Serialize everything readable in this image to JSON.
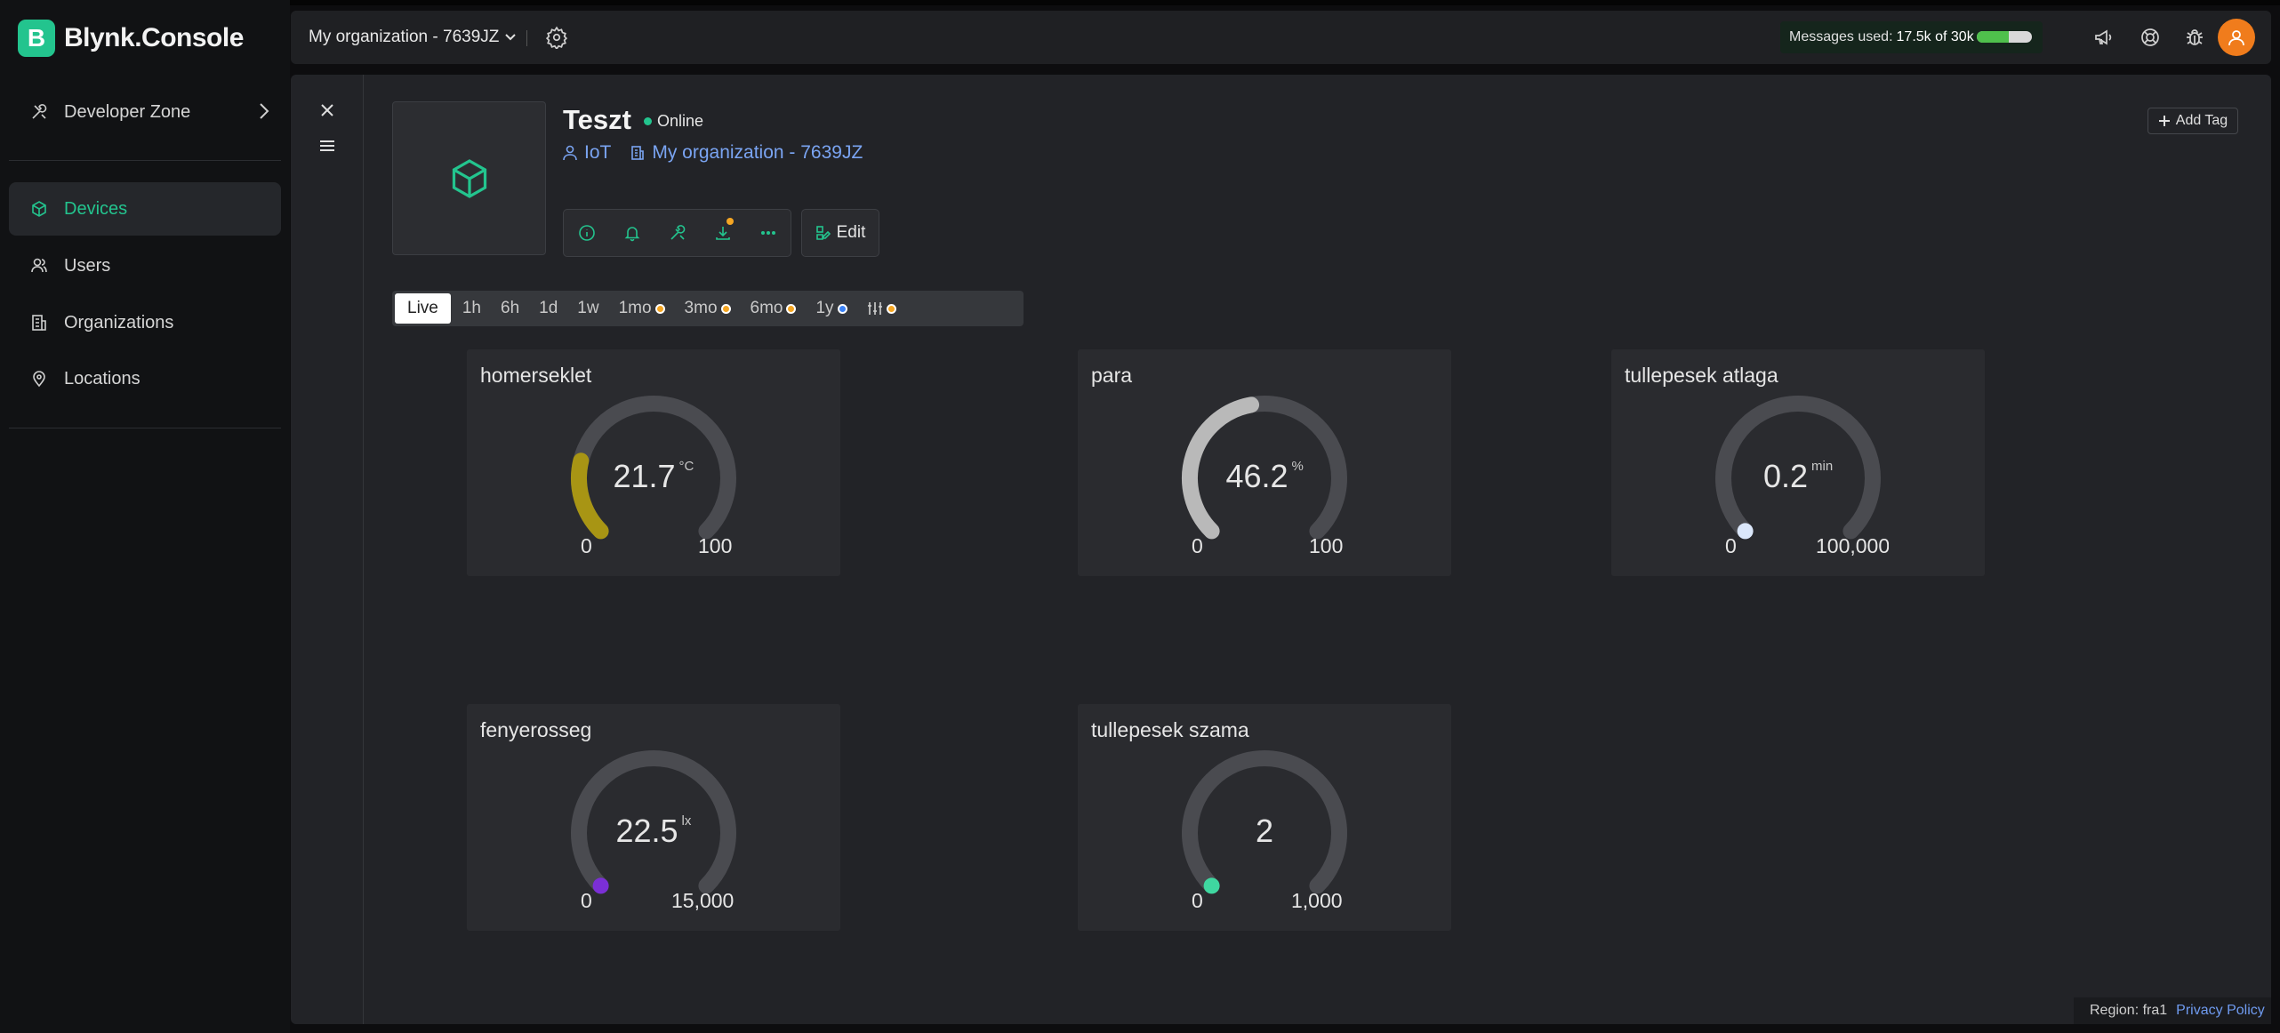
{
  "app": {
    "logo_letter": "B",
    "name": "Blynk.Console"
  },
  "sidebar": {
    "developer_zone": "Developer Zone",
    "items": [
      {
        "label": "Devices",
        "icon": "cube-icon",
        "active": true
      },
      {
        "label": "Users",
        "icon": "users-icon"
      },
      {
        "label": "Organizations",
        "icon": "building-icon"
      },
      {
        "label": "Locations",
        "icon": "location-pin-icon"
      }
    ]
  },
  "topbar": {
    "organization": "My organization - 7639JZ",
    "messages_label": "Messages used:",
    "messages_value": "17.5k of 30k",
    "messages_fraction": 0.58
  },
  "device": {
    "name": "Teszt",
    "status": "Online",
    "template": "IoT",
    "organization": "My organization - 7639JZ",
    "edit_label": "Edit",
    "add_tag_label": "Add Tag"
  },
  "ranges": [
    {
      "label": "Live",
      "active": true
    },
    {
      "label": "1h"
    },
    {
      "label": "6h"
    },
    {
      "label": "1d"
    },
    {
      "label": "1w"
    },
    {
      "label": "1mo",
      "dot": "#f5a623"
    },
    {
      "label": "3mo",
      "dot": "#f5a623"
    },
    {
      "label": "6mo",
      "dot": "#f5a623"
    },
    {
      "label": "1y",
      "dot": "#3b82f6"
    },
    {
      "label": "",
      "dot": "#f5a623",
      "icon": "sliders-icon"
    }
  ],
  "widgets": [
    {
      "title": "homerseklet",
      "value": "21.7",
      "unit": "°C",
      "min": "0",
      "max": "100",
      "fraction": 0.217,
      "color": "#a89514"
    },
    {
      "title": "para",
      "value": "46.2",
      "unit": "%",
      "min": "0",
      "max": "100",
      "fraction": 0.462,
      "color": "#b9b9b9"
    },
    {
      "title": "tullepesek atlaga",
      "value": "0.2",
      "unit": "min",
      "min": "0",
      "max": "100,000",
      "fraction": 0.0,
      "color": "#dbe7fb"
    },
    {
      "title": "fenyerosseg",
      "value": "22.5",
      "unit": "lx",
      "min": "0",
      "max": "15,000",
      "fraction": 0.0015,
      "color": "#7b2fd6"
    },
    {
      "title": "tullepesek szama",
      "value": "2",
      "unit": "",
      "min": "0",
      "max": "1,000",
      "fraction": 0.002,
      "color": "#3fd7a0"
    }
  ],
  "footer": {
    "region": "Region: fra1",
    "privacy": "Privacy Policy"
  }
}
